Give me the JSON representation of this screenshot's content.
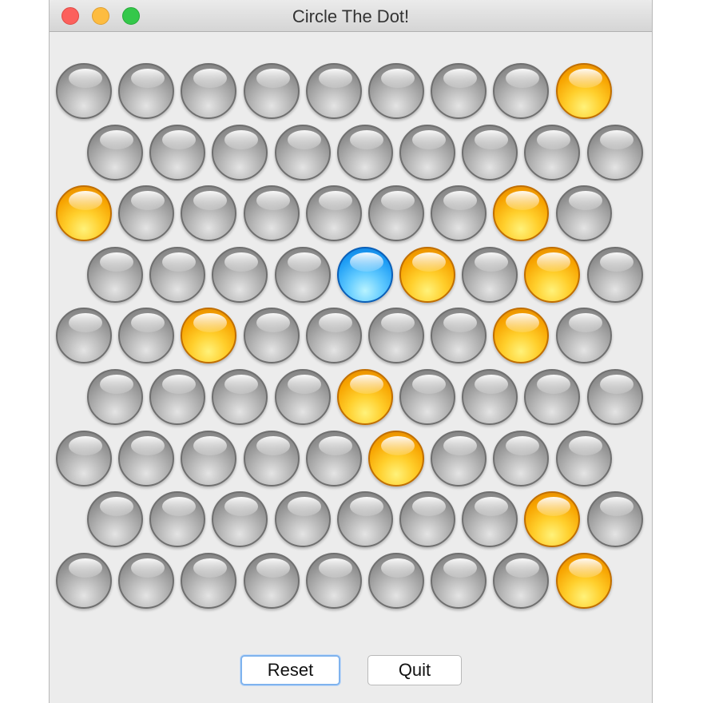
{
  "window": {
    "title": "Circle The Dot!"
  },
  "controls": {
    "close": "close-window",
    "minimize": "minimize-window",
    "maximize": "maximize-window"
  },
  "board": {
    "rows": [
      [
        "gray",
        "gray",
        "gray",
        "gray",
        "gray",
        "gray",
        "gray",
        "gray",
        "orange"
      ],
      [
        "gray",
        "gray",
        "gray",
        "gray",
        "gray",
        "gray",
        "gray",
        "gray",
        "gray"
      ],
      [
        "orange",
        "gray",
        "gray",
        "gray",
        "gray",
        "gray",
        "gray",
        "orange",
        "gray"
      ],
      [
        "gray",
        "gray",
        "gray",
        "gray",
        "blue",
        "orange",
        "gray",
        "orange",
        "gray"
      ],
      [
        "gray",
        "gray",
        "orange",
        "gray",
        "gray",
        "gray",
        "gray",
        "orange",
        "gray"
      ],
      [
        "gray",
        "gray",
        "gray",
        "gray",
        "orange",
        "gray",
        "gray",
        "gray",
        "gray"
      ],
      [
        "gray",
        "gray",
        "gray",
        "gray",
        "gray",
        "orange",
        "gray",
        "gray",
        "gray"
      ],
      [
        "gray",
        "gray",
        "gray",
        "gray",
        "gray",
        "gray",
        "gray",
        "orange",
        "gray"
      ],
      [
        "gray",
        "gray",
        "gray",
        "gray",
        "gray",
        "gray",
        "gray",
        "gray",
        "orange"
      ]
    ],
    "colors": {
      "gray": "#9a9a9a",
      "orange": "#f7a300",
      "blue": "#1f9ef5"
    }
  },
  "buttons": {
    "reset_label": "Reset",
    "quit_label": "Quit"
  }
}
